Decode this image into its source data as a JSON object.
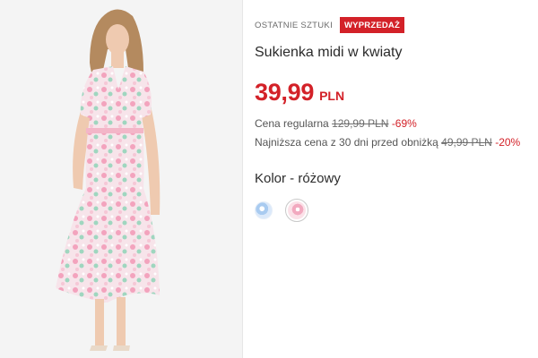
{
  "product": {
    "badges": {
      "last_items": "OSTATNIE SZTUKI",
      "sale": "WYPRZEDAŻ"
    },
    "title": "Sukienka midi w kwiaty",
    "price": {
      "value": "39,99",
      "currency": "PLN"
    },
    "regular_price": {
      "label": "Cena regularna",
      "old": "129,99 PLN",
      "discount": "-69%"
    },
    "lowest_price": {
      "label": "Najniższa cena z 30 dni przed obniżką",
      "old": "49,99 PLN",
      "discount": "-20%"
    },
    "color": {
      "label": "Kolor - różowy",
      "swatches": [
        {
          "name": "blue-floral",
          "selected": false,
          "color": "#a9cbf0"
        },
        {
          "name": "pink-floral",
          "selected": true,
          "color": "#f2a9bf"
        }
      ]
    }
  },
  "colors": {
    "accent": "#d32128",
    "text": "#2b2b2b",
    "muted": "#6b6b6b"
  }
}
